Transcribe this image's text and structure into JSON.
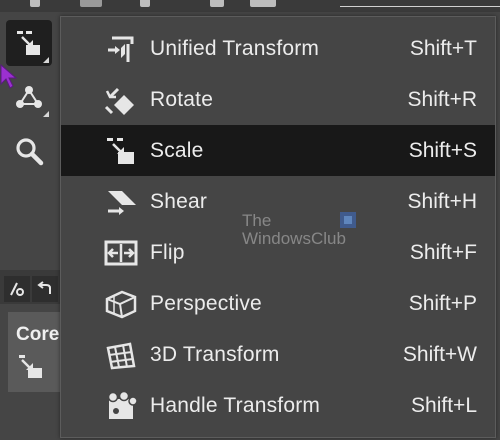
{
  "toolbox": {
    "dock_label": "Core"
  },
  "menu": {
    "items": [
      {
        "label": "Unified Transform",
        "shortcut": "Shift+T",
        "icon": "unified-transform-icon"
      },
      {
        "label": "Rotate",
        "shortcut": "Shift+R",
        "icon": "rotate-icon"
      },
      {
        "label": "Scale",
        "shortcut": "Shift+S",
        "icon": "scale-icon",
        "highlighted": true
      },
      {
        "label": "Shear",
        "shortcut": "Shift+H",
        "icon": "shear-icon"
      },
      {
        "label": "Flip",
        "shortcut": "Shift+F",
        "icon": "flip-icon"
      },
      {
        "label": "Perspective",
        "shortcut": "Shift+P",
        "icon": "perspective-icon"
      },
      {
        "label": "3D Transform",
        "shortcut": "Shift+W",
        "icon": "3d-transform-icon"
      },
      {
        "label": "Handle Transform",
        "shortcut": "Shift+L",
        "icon": "handle-transform-icon"
      }
    ]
  },
  "watermark": {
    "line1": "The",
    "line2": "WindowsClub"
  },
  "colors": {
    "background": "#454545",
    "highlight": "#181818",
    "text": "#ececec",
    "cursor": "#9b30d0"
  }
}
